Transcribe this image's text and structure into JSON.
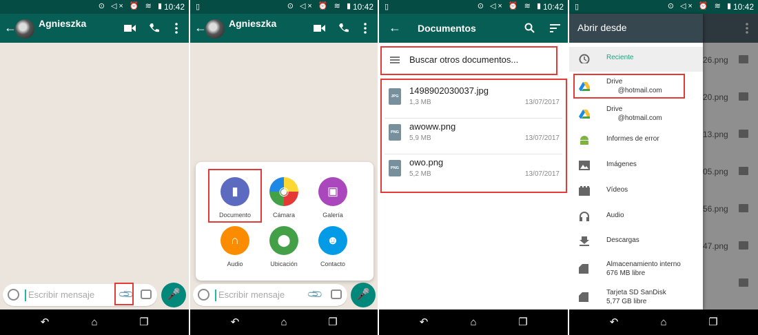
{
  "status": {
    "time": "10:42",
    "icons": "⊙ ◁× ⏰ ≋ ▮"
  },
  "chat": {
    "contact_name": "Agnieszka",
    "input_placeholder": "Escribir mensaje"
  },
  "attach_menu": {
    "items": [
      {
        "label": "Documento",
        "color": "#5c6bc0",
        "icon": "document-icon"
      },
      {
        "label": "Cámara",
        "color": "#f4511e",
        "icon": "camera-icon"
      },
      {
        "label": "Galería",
        "color": "#ab47bc",
        "icon": "gallery-icon"
      },
      {
        "label": "Audio",
        "color": "#fb8c00",
        "icon": "headphones-icon"
      },
      {
        "label": "Ubicación",
        "color": "#43a047",
        "icon": "location-icon"
      },
      {
        "label": "Contacto",
        "color": "#039be5",
        "icon": "contact-icon"
      }
    ]
  },
  "documents": {
    "title": "Documentos",
    "search_other": "Buscar otros documentos...",
    "files": [
      {
        "name": "1498902030037.jpg",
        "type": "JPG",
        "size": "1,3 MB",
        "date": "13/07/2017"
      },
      {
        "name": "awoww.png",
        "type": "PNG",
        "size": "5,9 MB",
        "date": "13/07/2017"
      },
      {
        "name": "owo.png",
        "type": "PNG",
        "size": "5,2 MB",
        "date": "13/07/2017"
      }
    ]
  },
  "open_from": {
    "title": "Abrir desde",
    "recent": "Reciente",
    "accent": "#1fa37e",
    "items": [
      {
        "label": "Drive",
        "sub": "@hotmail.com",
        "icon": "drive-icon"
      },
      {
        "label": "Drive",
        "sub": "@hotmail.com",
        "icon": "drive-icon"
      },
      {
        "label": "Informes de error",
        "sub": "",
        "icon": "android-icon"
      },
      {
        "label": "Imágenes",
        "sub": "",
        "icon": "image-icon"
      },
      {
        "label": "Vídeos",
        "sub": "",
        "icon": "video-icon"
      },
      {
        "label": "Audio",
        "sub": "",
        "icon": "audio-icon"
      },
      {
        "label": "Descargas",
        "sub": "",
        "icon": "download-icon"
      },
      {
        "label": "Almacenamiento interno",
        "sub": "676 MB libre",
        "icon": "sdcard-icon"
      },
      {
        "label": "Tarjeta SD SanDisk",
        "sub": "5,77 GB libre",
        "icon": "sdcard-icon"
      }
    ],
    "background_files": [
      "26.png",
      "20.png",
      "13.png",
      "05.png",
      "56.png",
      "47.png",
      ""
    ]
  },
  "highlight_color": "#e53935"
}
